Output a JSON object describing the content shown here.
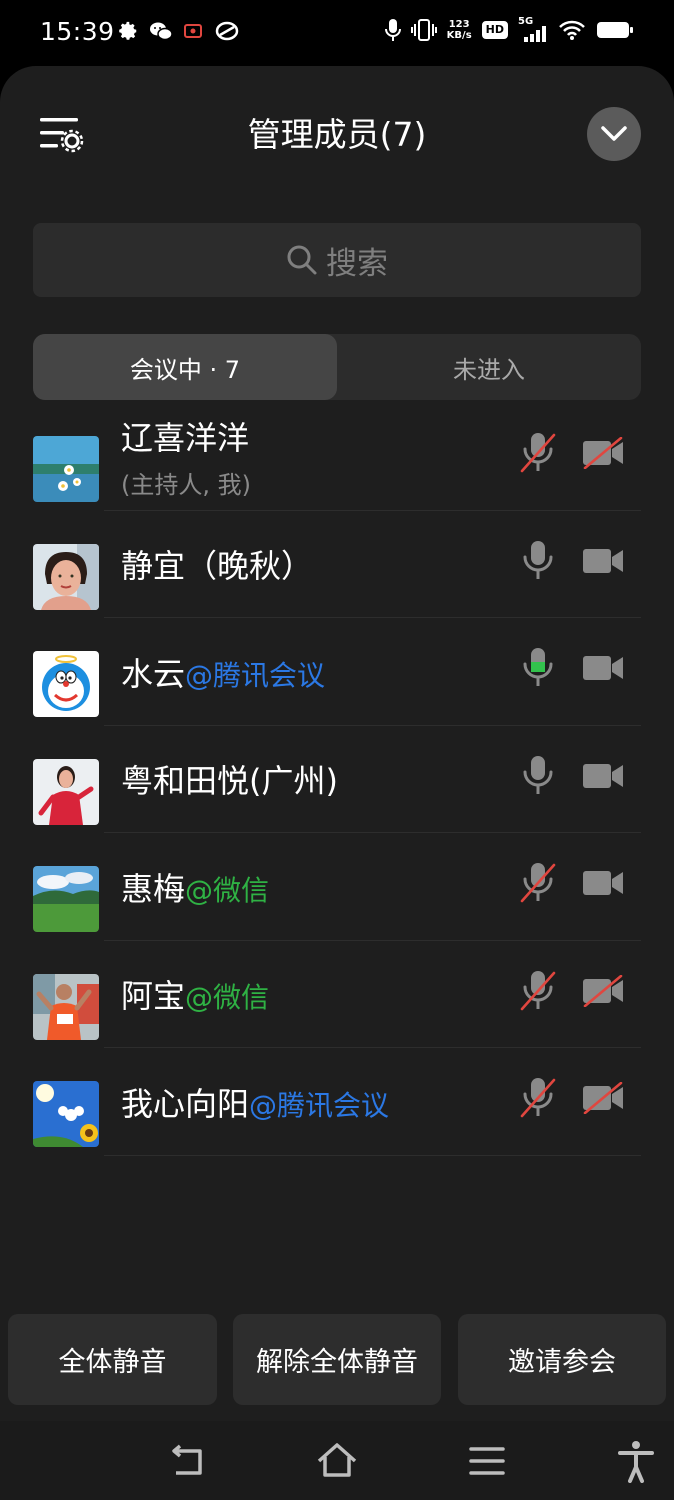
{
  "status_bar": {
    "time": "15:39",
    "net_speed_value": "123",
    "net_speed_unit": "KB/s",
    "hd_label": "HD",
    "network_label": "5G"
  },
  "header": {
    "title": "管理成员(7)"
  },
  "search": {
    "placeholder": "搜索"
  },
  "tabs": [
    {
      "label": "会议中 · 7",
      "active": true
    },
    {
      "label": "未进入",
      "active": false
    }
  ],
  "members": [
    {
      "name": "辽喜洋洋",
      "suffix": "",
      "suffix_type": "",
      "subtitle": "(主持人, 我)",
      "mic": "muted",
      "camera": "off",
      "avatar": "lake-flowers-avatar"
    },
    {
      "name": "静宜（晚秋）",
      "suffix": "",
      "suffix_type": "",
      "subtitle": "",
      "mic": "on",
      "camera": "on",
      "avatar": "woman-portrait-avatar"
    },
    {
      "name": "水云",
      "suffix": "@腾讯会议",
      "suffix_type": "tencent",
      "subtitle": "",
      "mic": "speaking",
      "camera": "on",
      "avatar": "doraemon-avatar"
    },
    {
      "name": "粤和田悦(广州)",
      "suffix": "",
      "suffix_type": "",
      "subtitle": "",
      "mic": "on",
      "camera": "on",
      "avatar": "woman-red-avatar"
    },
    {
      "name": "惠梅",
      "suffix": "@微信",
      "suffix_type": "wechat",
      "subtitle": "",
      "mic": "muted",
      "camera": "on",
      "avatar": "green-landscape-avatar"
    },
    {
      "name": "阿宝",
      "suffix": "@微信",
      "suffix_type": "wechat",
      "subtitle": "",
      "mic": "muted",
      "camera": "off",
      "avatar": "runner-avatar"
    },
    {
      "name": "我心向阳",
      "suffix": "@腾讯会议",
      "suffix_type": "tencent",
      "subtitle": "",
      "mic": "muted",
      "camera": "off",
      "avatar": "sunflower-sky-avatar"
    }
  ],
  "bottom_actions": {
    "mute_all": "全体静音",
    "unmute_all": "解除全体静音",
    "invite": "邀请参会"
  },
  "colors": {
    "sheet_bg": "#1e1e1e",
    "tencent_blue": "#2b78e4",
    "wechat_green": "#2fb244",
    "muted_red": "#e0463f",
    "speaking_green": "#33c24d"
  }
}
